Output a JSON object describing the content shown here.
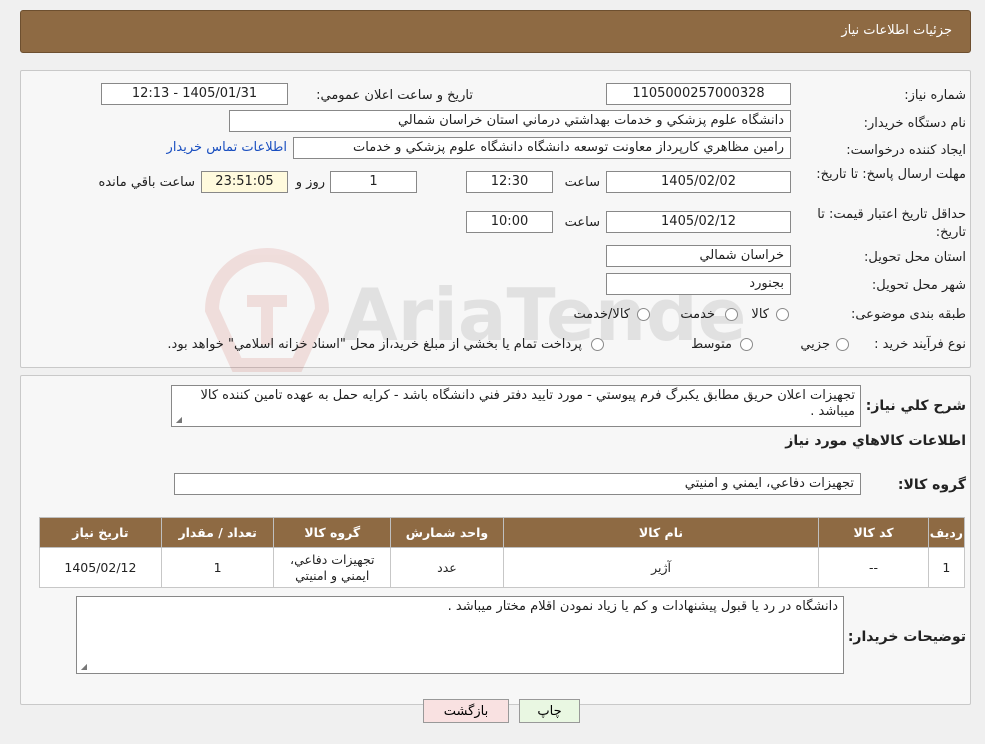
{
  "header": {
    "title": "جزئيات اطلاعات نياز"
  },
  "form": {
    "need_number_label": "شماره نياز:",
    "need_number": "1105000257000328",
    "announce_label": "تاريخ و ساعت اعلان عمومي:",
    "announce_value": "1405/01/31 - 12:13",
    "buyer_org_label": "نام دستگاه خريدار:",
    "buyer_org": "دانشگاه علوم پزشكي و خدمات بهداشتي درماني استان خراسان شمالي",
    "creator_label": "ايجاد كننده درخواست:",
    "creator": "رامين مظاهري كارپرداز معاونت توسعه دانشگاه دانشگاه علوم پزشكي و خدمات",
    "contact_link": "اطلاعات تماس خريدار",
    "deadline_label": "مهلت ارسال پاسخ: تا تاريخ:",
    "deadline_date": "1405/02/02",
    "time_label": "ساعت",
    "deadline_time": "12:30",
    "days_value": "1",
    "days_label": "روز و",
    "remaining_time": "23:51:05",
    "remaining_label": "ساعت باقي مانده",
    "validity_label": "حداقل تاريخ اعتبار قيمت: تا تاريخ:",
    "validity_date": "1405/02/12",
    "validity_time": "10:00",
    "province_label": "استان محل تحويل:",
    "province": "خراسان شمالي",
    "city_label": "شهر محل تحويل:",
    "city": "بجنورد",
    "category_label": "طبقه بندی موضوعی:",
    "category_options": [
      "كالا",
      "خدمت",
      "كالا/خدمت"
    ],
    "process_label": "نوع فرآيند خريد :",
    "process_options": [
      "جزيي",
      "متوسط"
    ],
    "process_note": "پرداخت تمام يا بخشي از مبلغ خريد،از محل \"اسناد خزانه اسلامي\" خواهد بود."
  },
  "description": {
    "label": "شرح كلي نياز:",
    "text": "تجهيزات اعلان حريق مطابق يكبرگ فرم پيوستي - مورد تاييد دفتر فني دانشگاه باشد - كرايه حمل به عهده تامين كننده كالا ميباشد .",
    "goods_info_title": "اطلاعات كالاهاي مورد نياز",
    "goods_group_label": "گروه كالا:",
    "goods_group": "تجهيزات دفاعي، ايمني و امنيتي"
  },
  "table": {
    "headers": [
      "رديف",
      "كد كالا",
      "نام كالا",
      "واحد شمارش",
      "گروه كالا",
      "تعداد / مقدار",
      "تاريخ نياز"
    ],
    "rows": [
      [
        "1",
        "--",
        "آژير",
        "عدد",
        "تجهيزات دفاعي، ايمني و امنيتي",
        "1",
        "1405/02/12"
      ]
    ]
  },
  "buyer_notes": {
    "label": "توضيحات خريدار:",
    "text": "دانشگاه در رد يا قبول پيشنهادات و كم يا زياد نمودن اقلام مختار ميباشد ."
  },
  "buttons": {
    "print": "چاپ",
    "back": "بازگشت"
  },
  "watermark_text": "AriaTender.neT",
  "colors": {
    "header": "#8e6a43",
    "link": "#1a4fc0",
    "print_btn": "#e9f7e2",
    "back_btn": "#f9e1e1"
  }
}
